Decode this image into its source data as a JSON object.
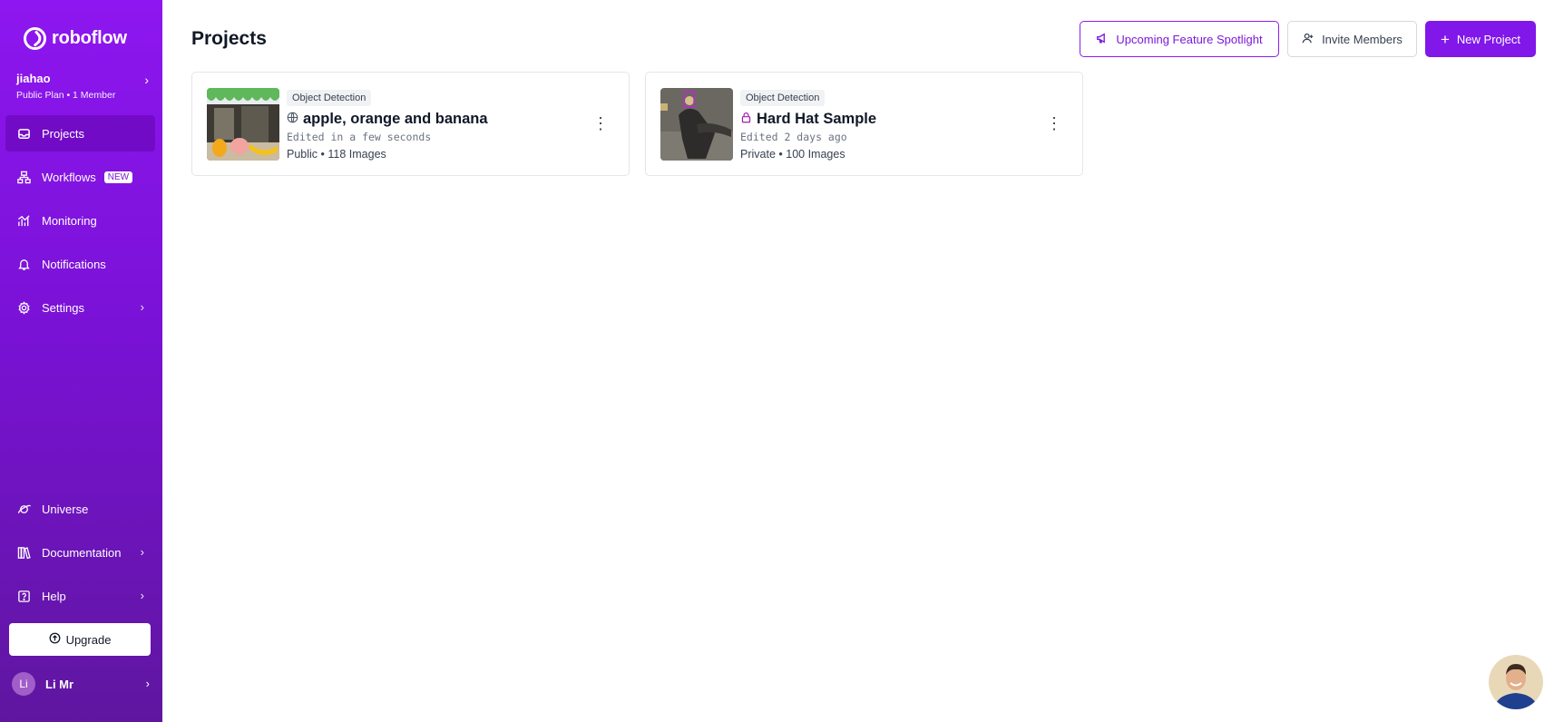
{
  "brand": {
    "name": "roboflow"
  },
  "workspace": {
    "name": "jiahao",
    "plan": "Public Plan",
    "members": "1 Member"
  },
  "nav": {
    "projects": "Projects",
    "workflows": "Workflows",
    "workflows_badge": "NEW",
    "monitoring": "Monitoring",
    "notifications": "Notifications",
    "settings": "Settings",
    "universe": "Universe",
    "documentation": "Documentation",
    "help": "Help"
  },
  "upgrade_label": "Upgrade",
  "user": {
    "initials": "Li",
    "name": "Li Mr"
  },
  "header": {
    "title": "Projects",
    "spotlight_label": "Upcoming Feature Spotlight",
    "invite_label": "Invite Members",
    "new_project_label": "New Project"
  },
  "projects": [
    {
      "type": "Object Detection",
      "title": "apple, orange and banana",
      "visibility_icon": "globe-icon",
      "edited": "Edited in a few seconds",
      "visibility": "Public",
      "images": "118 Images"
    },
    {
      "type": "Object Detection",
      "title": "Hard Hat Sample",
      "visibility_icon": "lock-icon",
      "edited": "Edited 2 days ago",
      "visibility": "Private",
      "images": "100 Images"
    }
  ],
  "colors": {
    "accent": "#8117e8",
    "sidebar_top": "#8e16f0",
    "sidebar_bottom": "#5f169f"
  }
}
